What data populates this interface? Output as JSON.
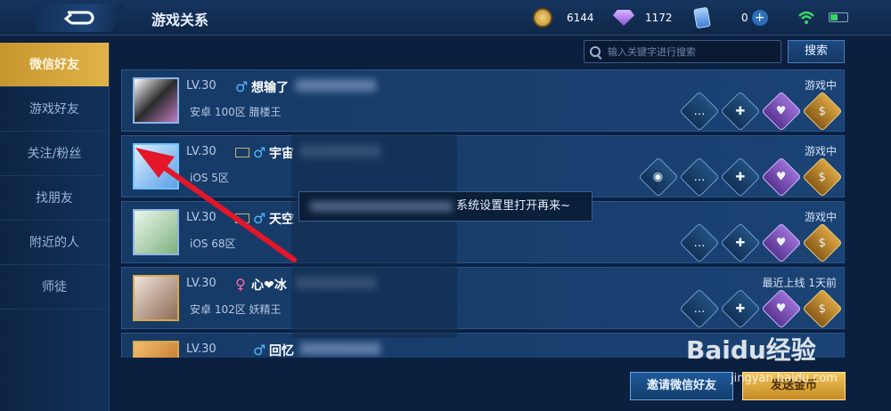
{
  "header": {
    "title": "游戏关系",
    "resources": [
      {
        "icon": "coin-icon",
        "value": "6144"
      },
      {
        "icon": "gem-icon",
        "value": "1172"
      },
      {
        "icon": "card-icon",
        "value": "0"
      }
    ]
  },
  "sidebar": {
    "items": [
      {
        "label": "微信好友",
        "active": true
      },
      {
        "label": "游戏好友"
      },
      {
        "label": "关注/粉丝"
      },
      {
        "label": "找朋友"
      },
      {
        "label": "附近的人"
      },
      {
        "label": "师徒"
      }
    ]
  },
  "search": {
    "placeholder": "输入关键字进行搜索",
    "button_label": "搜索"
  },
  "friends": [
    {
      "level": "LV.30",
      "gender": "♂",
      "name": "想输了",
      "server": "安卓 100区  腊楼王",
      "status": "游戏中"
    },
    {
      "level": "LV.30",
      "gender": "♂",
      "name": "宇宙",
      "server": "iOS 5区",
      "status": "游戏中"
    },
    {
      "level": "LV.30",
      "gender": "♂",
      "name": "天空",
      "server": "iOS 68区",
      "status": "游戏中"
    },
    {
      "level": "LV.30",
      "gender": "♀",
      "name": "心❤冰",
      "server": "安卓 102区  妖精王",
      "status": "最近上线  1天前"
    },
    {
      "level": "LV.30",
      "gender": "♂",
      "name": "回忆",
      "server": "",
      "status": ""
    }
  ],
  "toast": {
    "text": "系统设置里打开再来~"
  },
  "footer": {
    "invite_label": "邀请微信好友",
    "send_label": "发送金币"
  },
  "watermark": {
    "brand": "Baidu经验",
    "url": "jingyan.baidu.com"
  },
  "colors": {
    "accent_gold": "#e2b24a",
    "male": "#4fb6ff",
    "female": "#ff6ab0",
    "arrow": "#e3162a"
  }
}
